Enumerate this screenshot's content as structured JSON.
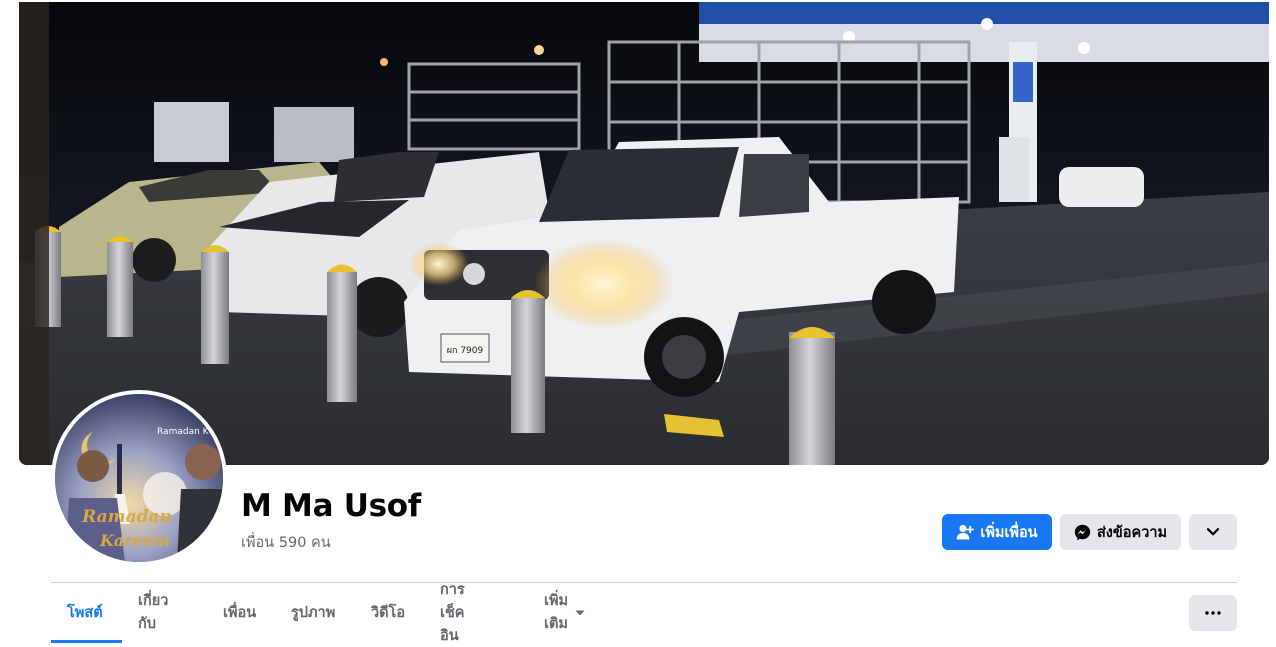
{
  "profile": {
    "name": "M Ma Usof",
    "friends_text": "เพื่อน 590 คน"
  },
  "avatar": {
    "caption_top": "Ramadan K",
    "caption_script_1": "Ramadan",
    "caption_script_2": "Kareem"
  },
  "cover": {
    "license_plate": "ผก 7909"
  },
  "actions": {
    "add_friend_label": "เพิ่มเพื่อน",
    "message_label": "ส่งข้อความ"
  },
  "tabs": [
    {
      "label": "โพสต์",
      "active": true
    },
    {
      "label": "เกี่ยวกับ",
      "active": false
    },
    {
      "label": "เพื่อน",
      "active": false
    },
    {
      "label": "รูปภาพ",
      "active": false
    },
    {
      "label": "วิดีโอ",
      "active": false
    },
    {
      "label": "การเช็คอิน",
      "active": false
    },
    {
      "label": "เพิ่มเติม",
      "active": false
    }
  ],
  "icons": {
    "add_friend": "person-plus-icon",
    "message": "messenger-icon",
    "dropdown": "chevron-down-icon",
    "more_tab": "caret-down-icon",
    "options": "ellipsis-icon"
  },
  "colors": {
    "primary": "#1877f2",
    "secondary_button": "#e4e6eb",
    "text_primary": "#050505",
    "text_secondary": "#65676b",
    "divider": "#ced0d4"
  }
}
